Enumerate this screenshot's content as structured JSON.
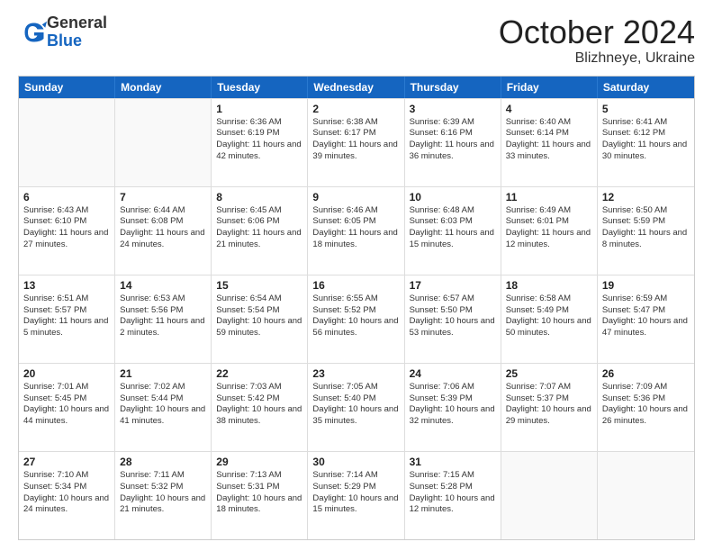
{
  "header": {
    "logo_general": "General",
    "logo_blue": "Blue",
    "month_title": "October 2024",
    "location": "Blizhneye, Ukraine"
  },
  "days_of_week": [
    "Sunday",
    "Monday",
    "Tuesday",
    "Wednesday",
    "Thursday",
    "Friday",
    "Saturday"
  ],
  "weeks": [
    [
      {
        "day": "",
        "info": ""
      },
      {
        "day": "",
        "info": ""
      },
      {
        "day": "1",
        "info": "Sunrise: 6:36 AM\nSunset: 6:19 PM\nDaylight: 11 hours and 42 minutes."
      },
      {
        "day": "2",
        "info": "Sunrise: 6:38 AM\nSunset: 6:17 PM\nDaylight: 11 hours and 39 minutes."
      },
      {
        "day": "3",
        "info": "Sunrise: 6:39 AM\nSunset: 6:16 PM\nDaylight: 11 hours and 36 minutes."
      },
      {
        "day": "4",
        "info": "Sunrise: 6:40 AM\nSunset: 6:14 PM\nDaylight: 11 hours and 33 minutes."
      },
      {
        "day": "5",
        "info": "Sunrise: 6:41 AM\nSunset: 6:12 PM\nDaylight: 11 hours and 30 minutes."
      }
    ],
    [
      {
        "day": "6",
        "info": "Sunrise: 6:43 AM\nSunset: 6:10 PM\nDaylight: 11 hours and 27 minutes."
      },
      {
        "day": "7",
        "info": "Sunrise: 6:44 AM\nSunset: 6:08 PM\nDaylight: 11 hours and 24 minutes."
      },
      {
        "day": "8",
        "info": "Sunrise: 6:45 AM\nSunset: 6:06 PM\nDaylight: 11 hours and 21 minutes."
      },
      {
        "day": "9",
        "info": "Sunrise: 6:46 AM\nSunset: 6:05 PM\nDaylight: 11 hours and 18 minutes."
      },
      {
        "day": "10",
        "info": "Sunrise: 6:48 AM\nSunset: 6:03 PM\nDaylight: 11 hours and 15 minutes."
      },
      {
        "day": "11",
        "info": "Sunrise: 6:49 AM\nSunset: 6:01 PM\nDaylight: 11 hours and 12 minutes."
      },
      {
        "day": "12",
        "info": "Sunrise: 6:50 AM\nSunset: 5:59 PM\nDaylight: 11 hours and 8 minutes."
      }
    ],
    [
      {
        "day": "13",
        "info": "Sunrise: 6:51 AM\nSunset: 5:57 PM\nDaylight: 11 hours and 5 minutes."
      },
      {
        "day": "14",
        "info": "Sunrise: 6:53 AM\nSunset: 5:56 PM\nDaylight: 11 hours and 2 minutes."
      },
      {
        "day": "15",
        "info": "Sunrise: 6:54 AM\nSunset: 5:54 PM\nDaylight: 10 hours and 59 minutes."
      },
      {
        "day": "16",
        "info": "Sunrise: 6:55 AM\nSunset: 5:52 PM\nDaylight: 10 hours and 56 minutes."
      },
      {
        "day": "17",
        "info": "Sunrise: 6:57 AM\nSunset: 5:50 PM\nDaylight: 10 hours and 53 minutes."
      },
      {
        "day": "18",
        "info": "Sunrise: 6:58 AM\nSunset: 5:49 PM\nDaylight: 10 hours and 50 minutes."
      },
      {
        "day": "19",
        "info": "Sunrise: 6:59 AM\nSunset: 5:47 PM\nDaylight: 10 hours and 47 minutes."
      }
    ],
    [
      {
        "day": "20",
        "info": "Sunrise: 7:01 AM\nSunset: 5:45 PM\nDaylight: 10 hours and 44 minutes."
      },
      {
        "day": "21",
        "info": "Sunrise: 7:02 AM\nSunset: 5:44 PM\nDaylight: 10 hours and 41 minutes."
      },
      {
        "day": "22",
        "info": "Sunrise: 7:03 AM\nSunset: 5:42 PM\nDaylight: 10 hours and 38 minutes."
      },
      {
        "day": "23",
        "info": "Sunrise: 7:05 AM\nSunset: 5:40 PM\nDaylight: 10 hours and 35 minutes."
      },
      {
        "day": "24",
        "info": "Sunrise: 7:06 AM\nSunset: 5:39 PM\nDaylight: 10 hours and 32 minutes."
      },
      {
        "day": "25",
        "info": "Sunrise: 7:07 AM\nSunset: 5:37 PM\nDaylight: 10 hours and 29 minutes."
      },
      {
        "day": "26",
        "info": "Sunrise: 7:09 AM\nSunset: 5:36 PM\nDaylight: 10 hours and 26 minutes."
      }
    ],
    [
      {
        "day": "27",
        "info": "Sunrise: 7:10 AM\nSunset: 5:34 PM\nDaylight: 10 hours and 24 minutes."
      },
      {
        "day": "28",
        "info": "Sunrise: 7:11 AM\nSunset: 5:32 PM\nDaylight: 10 hours and 21 minutes."
      },
      {
        "day": "29",
        "info": "Sunrise: 7:13 AM\nSunset: 5:31 PM\nDaylight: 10 hours and 18 minutes."
      },
      {
        "day": "30",
        "info": "Sunrise: 7:14 AM\nSunset: 5:29 PM\nDaylight: 10 hours and 15 minutes."
      },
      {
        "day": "31",
        "info": "Sunrise: 7:15 AM\nSunset: 5:28 PM\nDaylight: 10 hours and 12 minutes."
      },
      {
        "day": "",
        "info": ""
      },
      {
        "day": "",
        "info": ""
      }
    ]
  ]
}
